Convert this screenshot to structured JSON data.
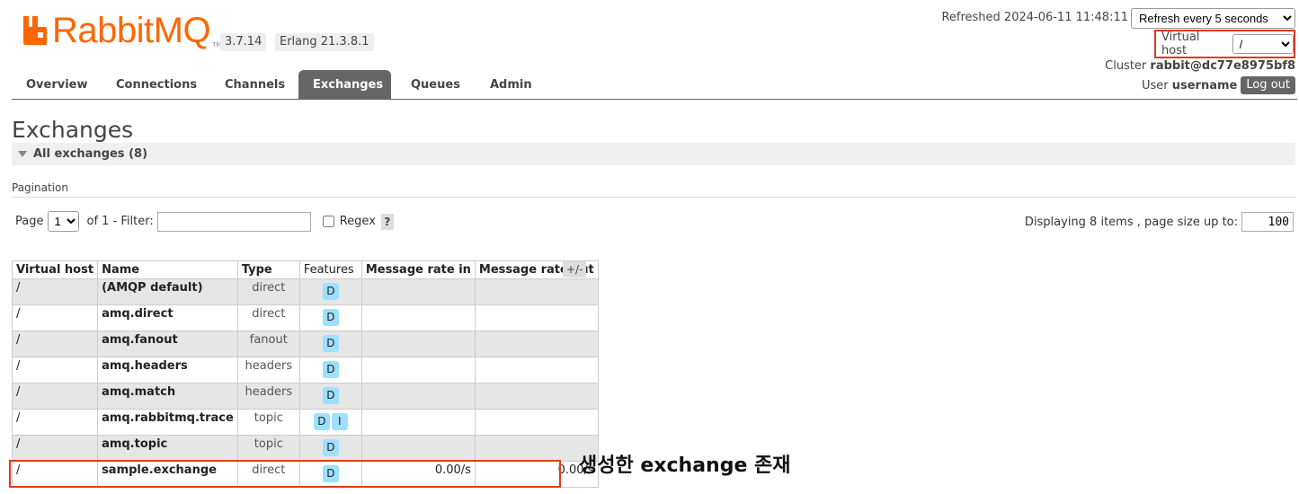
{
  "header": {
    "logo_text": "RabbitMQ",
    "logo_tm": "TM",
    "rabbitmq_version": "3.7.14",
    "erlang_version": "Erlang 21.3.8.1",
    "refreshed": "Refreshed 2024-06-11 11:48:11",
    "refresh_option": "Refresh every 5 seconds",
    "vhost_label": "Virtual host",
    "vhost_value": "/",
    "cluster_label": "Cluster",
    "cluster_name": "rabbit@dc77e8975bf8",
    "user_label": "User",
    "username": "username",
    "logout_label": "Log out",
    "brand_color": "#ff6600"
  },
  "nav": {
    "tabs": [
      {
        "label": "Overview"
      },
      {
        "label": "Connections"
      },
      {
        "label": "Channels"
      },
      {
        "label": "Exchanges",
        "active": true
      },
      {
        "label": "Queues"
      },
      {
        "label": "Admin"
      }
    ]
  },
  "page": {
    "title": "Exchanges",
    "section_label": "All exchanges (8)",
    "pagination_label": "Pagination",
    "page_label": "Page",
    "page_value": "1",
    "of_label": "of 1",
    "filter_label": "- Filter:",
    "filter_value": "",
    "regex_label": "Regex",
    "help_label": "?",
    "displaying_label": "Displaying 8 items , page size up to:",
    "page_size": "100"
  },
  "table": {
    "columns": [
      "Virtual host",
      "Name",
      "Type",
      "Features",
      "Message rate in",
      "Message rate out"
    ],
    "toggle_label": "+/-",
    "rows": [
      {
        "vhost": "/",
        "name": "(AMQP default)",
        "type": "direct",
        "features": [
          "D"
        ],
        "rate_in": "",
        "rate_out": ""
      },
      {
        "vhost": "/",
        "name": "amq.direct",
        "type": "direct",
        "features": [
          "D"
        ],
        "rate_in": "",
        "rate_out": ""
      },
      {
        "vhost": "/",
        "name": "amq.fanout",
        "type": "fanout",
        "features": [
          "D"
        ],
        "rate_in": "",
        "rate_out": ""
      },
      {
        "vhost": "/",
        "name": "amq.headers",
        "type": "headers",
        "features": [
          "D"
        ],
        "rate_in": "",
        "rate_out": ""
      },
      {
        "vhost": "/",
        "name": "amq.match",
        "type": "headers",
        "features": [
          "D"
        ],
        "rate_in": "",
        "rate_out": ""
      },
      {
        "vhost": "/",
        "name": "amq.rabbitmq.trace",
        "type": "topic",
        "features": [
          "D",
          "I"
        ],
        "rate_in": "",
        "rate_out": ""
      },
      {
        "vhost": "/",
        "name": "amq.topic",
        "type": "topic",
        "features": [
          "D"
        ],
        "rate_in": "",
        "rate_out": ""
      },
      {
        "vhost": "/",
        "name": "sample.exchange",
        "type": "direct",
        "features": [
          "D"
        ],
        "rate_in": "0.00/s",
        "rate_out": "0.00/s"
      }
    ]
  },
  "annotation": {
    "text": "생성한 exchange 존재",
    "highlight_color": "#e03a1e"
  }
}
